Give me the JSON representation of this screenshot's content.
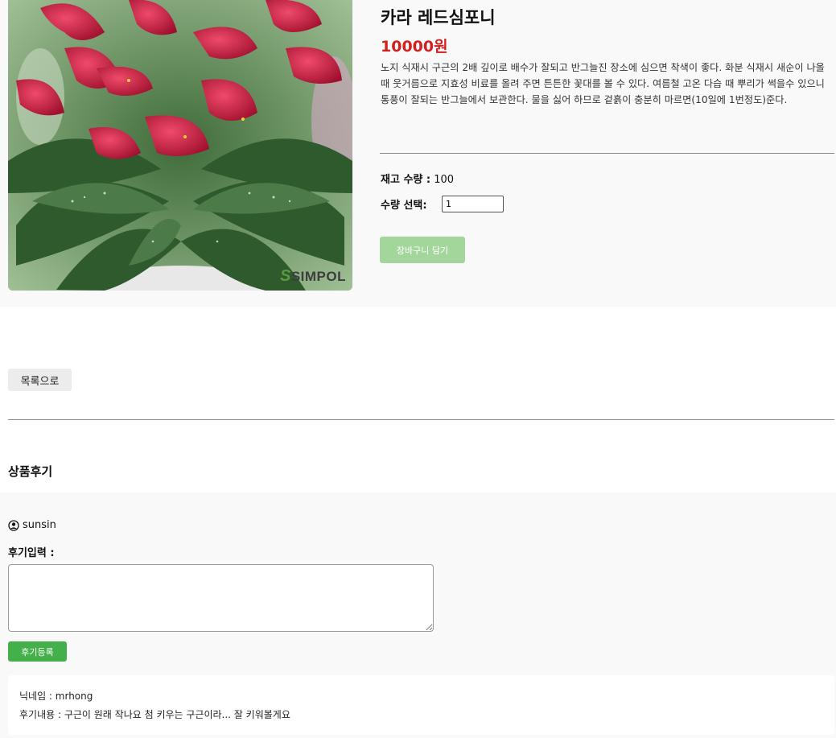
{
  "product": {
    "name": "카라 레드심포니",
    "price": "10000원",
    "description": "노지 식재시 구근의 2배 깊이로 배수가 잘되고 반그늘진 장소에 심으면 착색이 좋다. 화분 식재시 새순이 나올때 웃거름으로 지효성 비료를 올려 주면 튼튼한 꽃대를 볼 수 있다. 여름철 고온 다습 때 뿌리가 썩을수 있으니 통풍이 잘되는 반그늘에서 보관한다. 물을 싫어 하므로 겉흙이 충분히 마르면(10일에 1번정도)준다.",
    "image_logo": "SIMPOL",
    "stock_label": "재고 수량 :",
    "stock_value": "100",
    "qty_label": "수량 선택:",
    "qty_value": "1",
    "cart_button": "장바구니 담기"
  },
  "navigation": {
    "list_button": "목록으로"
  },
  "reviews": {
    "heading": "상품후기",
    "current_user": "sunsin",
    "user_icon": "user-circle-icon",
    "input_label": "후기입력 :",
    "submit_button": "후기등록",
    "items": [
      {
        "nickname": "닉네임 : mrhong",
        "content": "후기내용 : 구근이 원래 작나요 첨 키우는 구근이라... 잘 키워볼게요"
      }
    ]
  },
  "colors": {
    "price": "#d0201f",
    "cart_button_bg": "#a3d69a",
    "submit_button_bg": "#43b04a",
    "section_bg": "#f9f9f9"
  }
}
